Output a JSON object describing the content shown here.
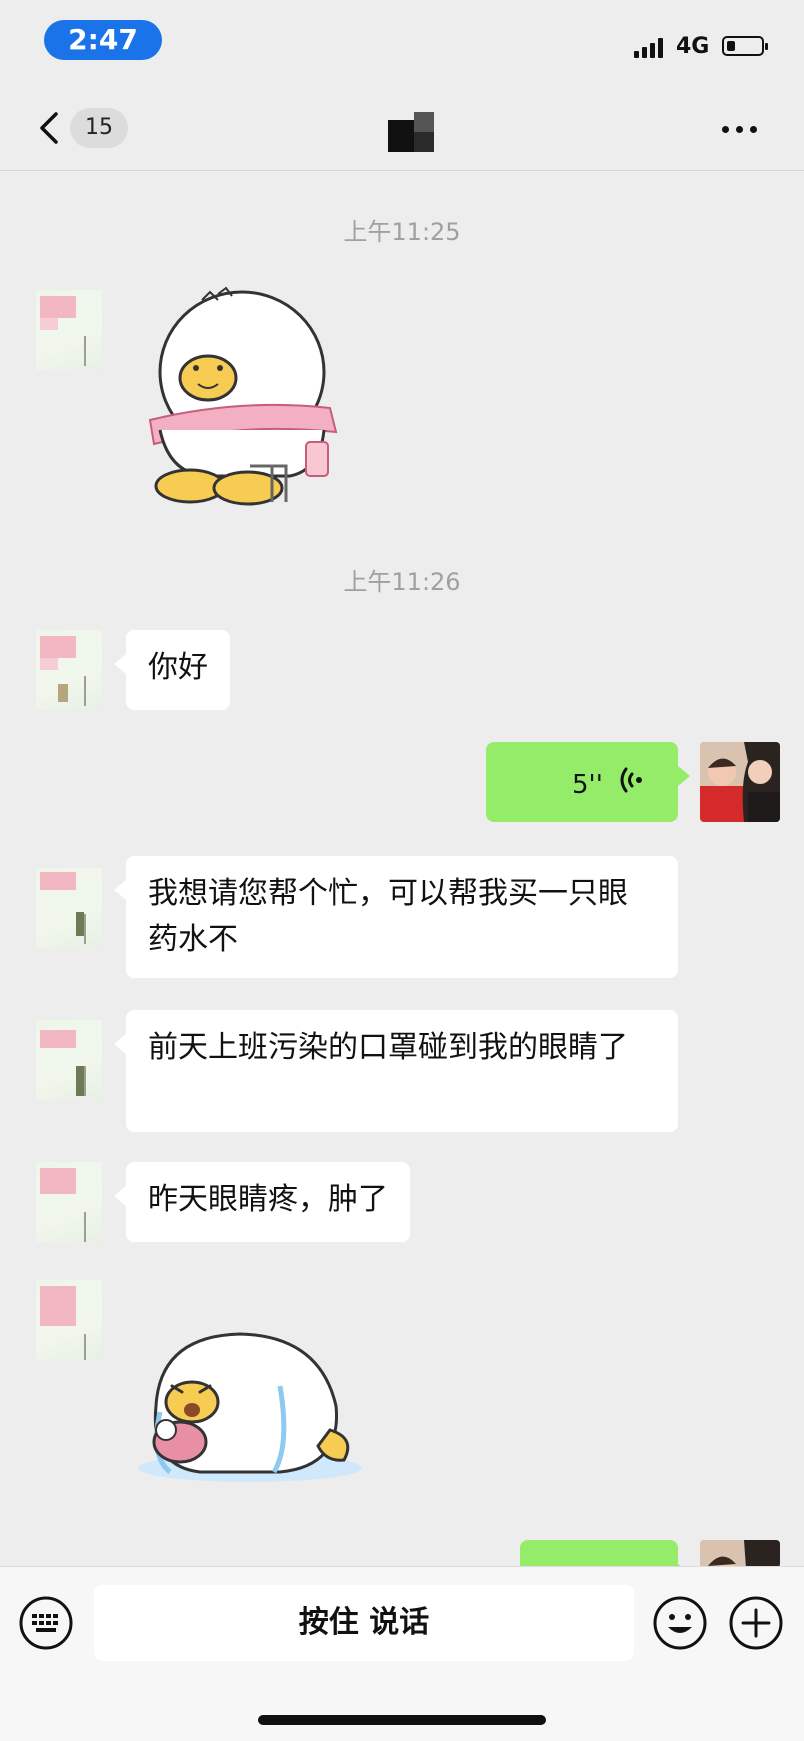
{
  "status_bar": {
    "time": "2:47",
    "network": "4G"
  },
  "nav": {
    "unread_count": "15"
  },
  "messages": {
    "timestamp_1": "上午11:25",
    "timestamp_2": "上午11:26",
    "msg_hello": "你好",
    "voice_duration": "5''",
    "msg_request": "我想请您帮个忙，可以帮我买一只眼药水不",
    "msg_reason": "前天上班污染的口罩碰到我的眼睛了",
    "msg_symptom": "昨天眼睛疼，肿了"
  },
  "input_bar": {
    "hold_to_talk": "按住 说话"
  },
  "colors": {
    "background": "#ededed",
    "sent_bubble": "#95ec69",
    "received_bubble": "#ffffff",
    "time_pill": "#1a73e8"
  },
  "icons": [
    "back-icon",
    "more-icon",
    "voice-icon",
    "keyboard-icon",
    "emoji-icon",
    "plus-icon",
    "signal-icon",
    "battery-icon"
  ]
}
